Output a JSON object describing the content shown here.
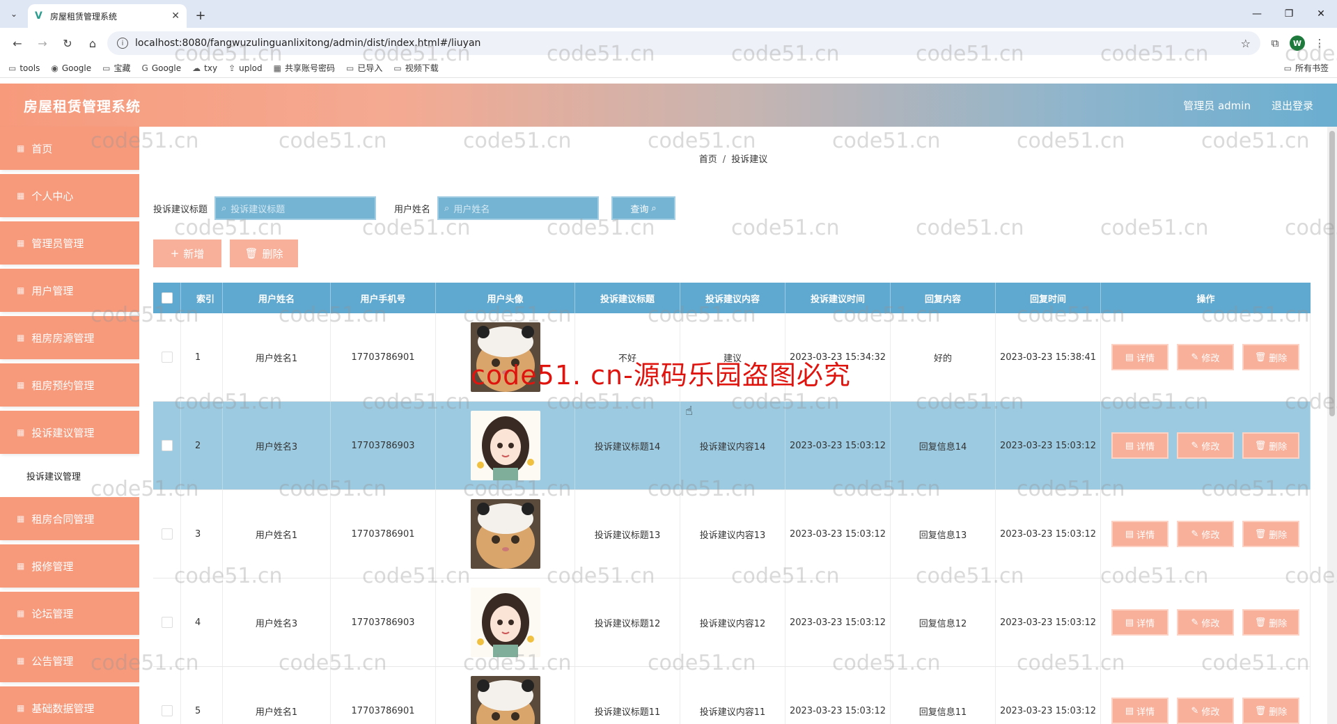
{
  "browser": {
    "tab_title": "房屋租赁管理系统",
    "url": "localhost:8080/fangwuzulinguanlixitong/admin/dist/index.html#/liuyan",
    "profile_initial": "W",
    "bookmarks": [
      "tools",
      "Google",
      "宝藏",
      "Google",
      "txy",
      "uplod",
      "共享账号密码",
      "已导入",
      "视频下载"
    ],
    "bookmarks_right": "所有书签"
  },
  "header": {
    "title": "房屋租赁管理系统",
    "user": "管理员 admin",
    "logout": "退出登录"
  },
  "sidebar": {
    "items": [
      {
        "label": "首页"
      },
      {
        "label": "个人中心"
      },
      {
        "label": "管理员管理"
      },
      {
        "label": "用户管理"
      },
      {
        "label": "租房房源管理"
      },
      {
        "label": "租房预约管理"
      },
      {
        "label": "投诉建议管理"
      }
    ],
    "submenu": "投诉建议管理",
    "items_after": [
      {
        "label": "租房合同管理"
      },
      {
        "label": "报修管理"
      },
      {
        "label": "论坛管理"
      },
      {
        "label": "公告管理"
      },
      {
        "label": "基础数据管理"
      }
    ]
  },
  "breadcrumb": {
    "home": "首页",
    "sep": "/",
    "current": "投诉建议"
  },
  "search": {
    "title_label": "投诉建议标题",
    "title_placeholder": "投诉建议标题",
    "name_label": "用户姓名",
    "name_placeholder": "用户姓名",
    "query": "查询"
  },
  "actions": {
    "add": "新增",
    "delete": "删除"
  },
  "table": {
    "headers": [
      "索引",
      "用户姓名",
      "用户手机号",
      "用户头像",
      "投诉建议标题",
      "投诉建议内容",
      "投诉建议时间",
      "回复内容",
      "回复时间",
      "操作"
    ],
    "op_labels": {
      "detail": "详情",
      "edit": "修改",
      "delete": "删除"
    },
    "rows": [
      {
        "idx": "1",
        "name": "用户姓名1",
        "phone": "17703786901",
        "avatar": "cat",
        "title": "不好",
        "content": "建议",
        "time": "2023-03-23 15:34:32",
        "reply": "好的",
        "rtime": "2023-03-23 15:38:41"
      },
      {
        "idx": "2",
        "name": "用户姓名3",
        "phone": "17703786903",
        "avatar": "girl",
        "title": "投诉建议标题14",
        "content": "投诉建议内容14",
        "time": "2023-03-23 15:03:12",
        "reply": "回复信息14",
        "rtime": "2023-03-23 15:03:12"
      },
      {
        "idx": "3",
        "name": "用户姓名1",
        "phone": "17703786901",
        "avatar": "cat",
        "title": "投诉建议标题13",
        "content": "投诉建议内容13",
        "time": "2023-03-23 15:03:12",
        "reply": "回复信息13",
        "rtime": "2023-03-23 15:03:12"
      },
      {
        "idx": "4",
        "name": "用户姓名3",
        "phone": "17703786903",
        "avatar": "girl",
        "title": "投诉建议标题12",
        "content": "投诉建议内容12",
        "time": "2023-03-23 15:03:12",
        "reply": "回复信息12",
        "rtime": "2023-03-23 15:03:12"
      },
      {
        "idx": "5",
        "name": "用户姓名1",
        "phone": "17703786901",
        "avatar": "cat",
        "title": "投诉建议标题11",
        "content": "投诉建议内容11",
        "time": "2023-03-23 15:03:12",
        "reply": "回复信息11",
        "rtime": "2023-03-23 15:03:12"
      }
    ]
  },
  "watermark": {
    "text": "code51.cn",
    "banner": "code51. cn-源码乐园盗图必究"
  },
  "colors": {
    "accent": "#f79a7c",
    "header_blue": "#5fa8cf",
    "highlight_row": "#9ccae0"
  }
}
